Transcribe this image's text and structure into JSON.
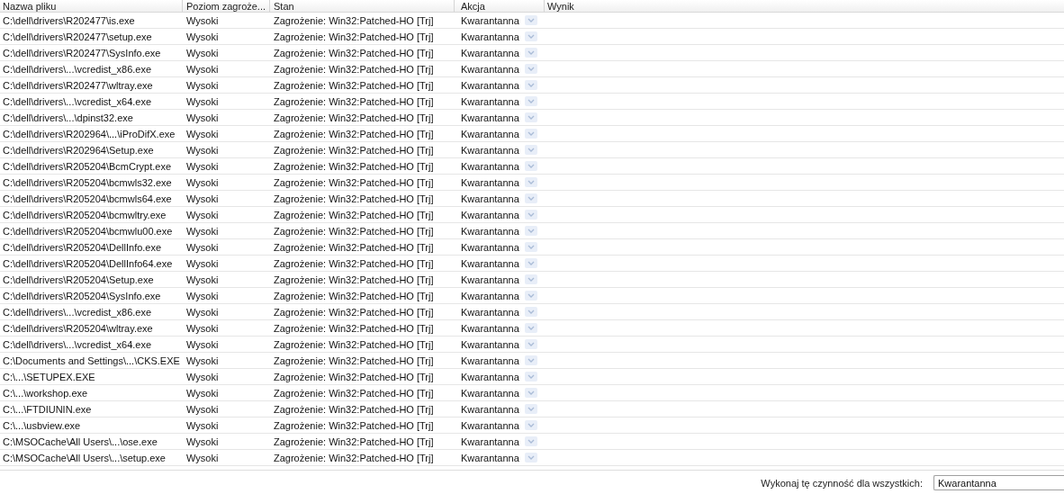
{
  "table": {
    "columns": [
      "Nazwa pliku",
      "Poziom zagroże...",
      "Stan",
      "Akcja",
      "Wynik"
    ],
    "rows": [
      {
        "file": "C:\\dell\\drivers\\R202477\\is.exe",
        "level": "Wysoki",
        "status": "Zagrożenie: Win32:Patched-HO [Trj]",
        "action": "Kwarantanna"
      },
      {
        "file": "C:\\dell\\drivers\\R202477\\setup.exe",
        "level": "Wysoki",
        "status": "Zagrożenie: Win32:Patched-HO [Trj]",
        "action": "Kwarantanna"
      },
      {
        "file": "C:\\dell\\drivers\\R202477\\SysInfo.exe",
        "level": "Wysoki",
        "status": "Zagrożenie: Win32:Patched-HO [Trj]",
        "action": "Kwarantanna"
      },
      {
        "file": "C:\\dell\\drivers\\...\\vcredist_x86.exe",
        "level": "Wysoki",
        "status": "Zagrożenie: Win32:Patched-HO [Trj]",
        "action": "Kwarantanna"
      },
      {
        "file": "C:\\dell\\drivers\\R202477\\wltray.exe",
        "level": "Wysoki",
        "status": "Zagrożenie: Win32:Patched-HO [Trj]",
        "action": "Kwarantanna"
      },
      {
        "file": "C:\\dell\\drivers\\...\\vcredist_x64.exe",
        "level": "Wysoki",
        "status": "Zagrożenie: Win32:Patched-HO [Trj]",
        "action": "Kwarantanna"
      },
      {
        "file": "C:\\dell\\drivers\\...\\dpinst32.exe",
        "level": "Wysoki",
        "status": "Zagrożenie: Win32:Patched-HO [Trj]",
        "action": "Kwarantanna"
      },
      {
        "file": "C:\\dell\\drivers\\R202964\\...\\iProDifX.exe",
        "level": "Wysoki",
        "status": "Zagrożenie: Win32:Patched-HO [Trj]",
        "action": "Kwarantanna"
      },
      {
        "file": "C:\\dell\\drivers\\R202964\\Setup.exe",
        "level": "Wysoki",
        "status": "Zagrożenie: Win32:Patched-HO [Trj]",
        "action": "Kwarantanna"
      },
      {
        "file": "C:\\dell\\drivers\\R205204\\BcmCrypt.exe",
        "level": "Wysoki",
        "status": "Zagrożenie: Win32:Patched-HO [Trj]",
        "action": "Kwarantanna"
      },
      {
        "file": "C:\\dell\\drivers\\R205204\\bcmwls32.exe",
        "level": "Wysoki",
        "status": "Zagrożenie: Win32:Patched-HO [Trj]",
        "action": "Kwarantanna"
      },
      {
        "file": "C:\\dell\\drivers\\R205204\\bcmwls64.exe",
        "level": "Wysoki",
        "status": "Zagrożenie: Win32:Patched-HO [Trj]",
        "action": "Kwarantanna"
      },
      {
        "file": "C:\\dell\\drivers\\R205204\\bcmwltry.exe",
        "level": "Wysoki",
        "status": "Zagrożenie: Win32:Patched-HO [Trj]",
        "action": "Kwarantanna"
      },
      {
        "file": "C:\\dell\\drivers\\R205204\\bcmwlu00.exe",
        "level": "Wysoki",
        "status": "Zagrożenie: Win32:Patched-HO [Trj]",
        "action": "Kwarantanna"
      },
      {
        "file": "C:\\dell\\drivers\\R205204\\DellInfo.exe",
        "level": "Wysoki",
        "status": "Zagrożenie: Win32:Patched-HO [Trj]",
        "action": "Kwarantanna"
      },
      {
        "file": "C:\\dell\\drivers\\R205204\\DellInfo64.exe",
        "level": "Wysoki",
        "status": "Zagrożenie: Win32:Patched-HO [Trj]",
        "action": "Kwarantanna"
      },
      {
        "file": "C:\\dell\\drivers\\R205204\\Setup.exe",
        "level": "Wysoki",
        "status": "Zagrożenie: Win32:Patched-HO [Trj]",
        "action": "Kwarantanna"
      },
      {
        "file": "C:\\dell\\drivers\\R205204\\SysInfo.exe",
        "level": "Wysoki",
        "status": "Zagrożenie: Win32:Patched-HO [Trj]",
        "action": "Kwarantanna"
      },
      {
        "file": "C:\\dell\\drivers\\...\\vcredist_x86.exe",
        "level": "Wysoki",
        "status": "Zagrożenie: Win32:Patched-HO [Trj]",
        "action": "Kwarantanna"
      },
      {
        "file": "C:\\dell\\drivers\\R205204\\wltray.exe",
        "level": "Wysoki",
        "status": "Zagrożenie: Win32:Patched-HO [Trj]",
        "action": "Kwarantanna"
      },
      {
        "file": "C:\\dell\\drivers\\...\\vcredist_x64.exe",
        "level": "Wysoki",
        "status": "Zagrożenie: Win32:Patched-HO [Trj]",
        "action": "Kwarantanna"
      },
      {
        "file": "C:\\Documents and Settings\\...\\CKS.EXE",
        "level": "Wysoki",
        "status": "Zagrożenie: Win32:Patched-HO [Trj]",
        "action": "Kwarantanna"
      },
      {
        "file": "C:\\...\\SETUPEX.EXE",
        "level": "Wysoki",
        "status": "Zagrożenie: Win32:Patched-HO [Trj]",
        "action": "Kwarantanna"
      },
      {
        "file": "C:\\...\\workshop.exe",
        "level": "Wysoki",
        "status": "Zagrożenie: Win32:Patched-HO [Trj]",
        "action": "Kwarantanna"
      },
      {
        "file": "C:\\...\\FTDIUNIN.exe",
        "level": "Wysoki",
        "status": "Zagrożenie: Win32:Patched-HO [Trj]",
        "action": "Kwarantanna"
      },
      {
        "file": "C:\\...\\usbview.exe",
        "level": "Wysoki",
        "status": "Zagrożenie: Win32:Patched-HO [Trj]",
        "action": "Kwarantanna"
      },
      {
        "file": "C:\\MSOCache\\All Users\\...\\ose.exe",
        "level": "Wysoki",
        "status": "Zagrożenie: Win32:Patched-HO [Trj]",
        "action": "Kwarantanna"
      },
      {
        "file": "C:\\MSOCache\\All Users\\...\\setup.exe",
        "level": "Wysoki",
        "status": "Zagrożenie: Win32:Patched-HO [Trj]",
        "action": "Kwarantanna"
      }
    ]
  },
  "footer": {
    "label": "Wykonaj tę czynność dla wszystkich:",
    "value": "Kwarantanna"
  }
}
